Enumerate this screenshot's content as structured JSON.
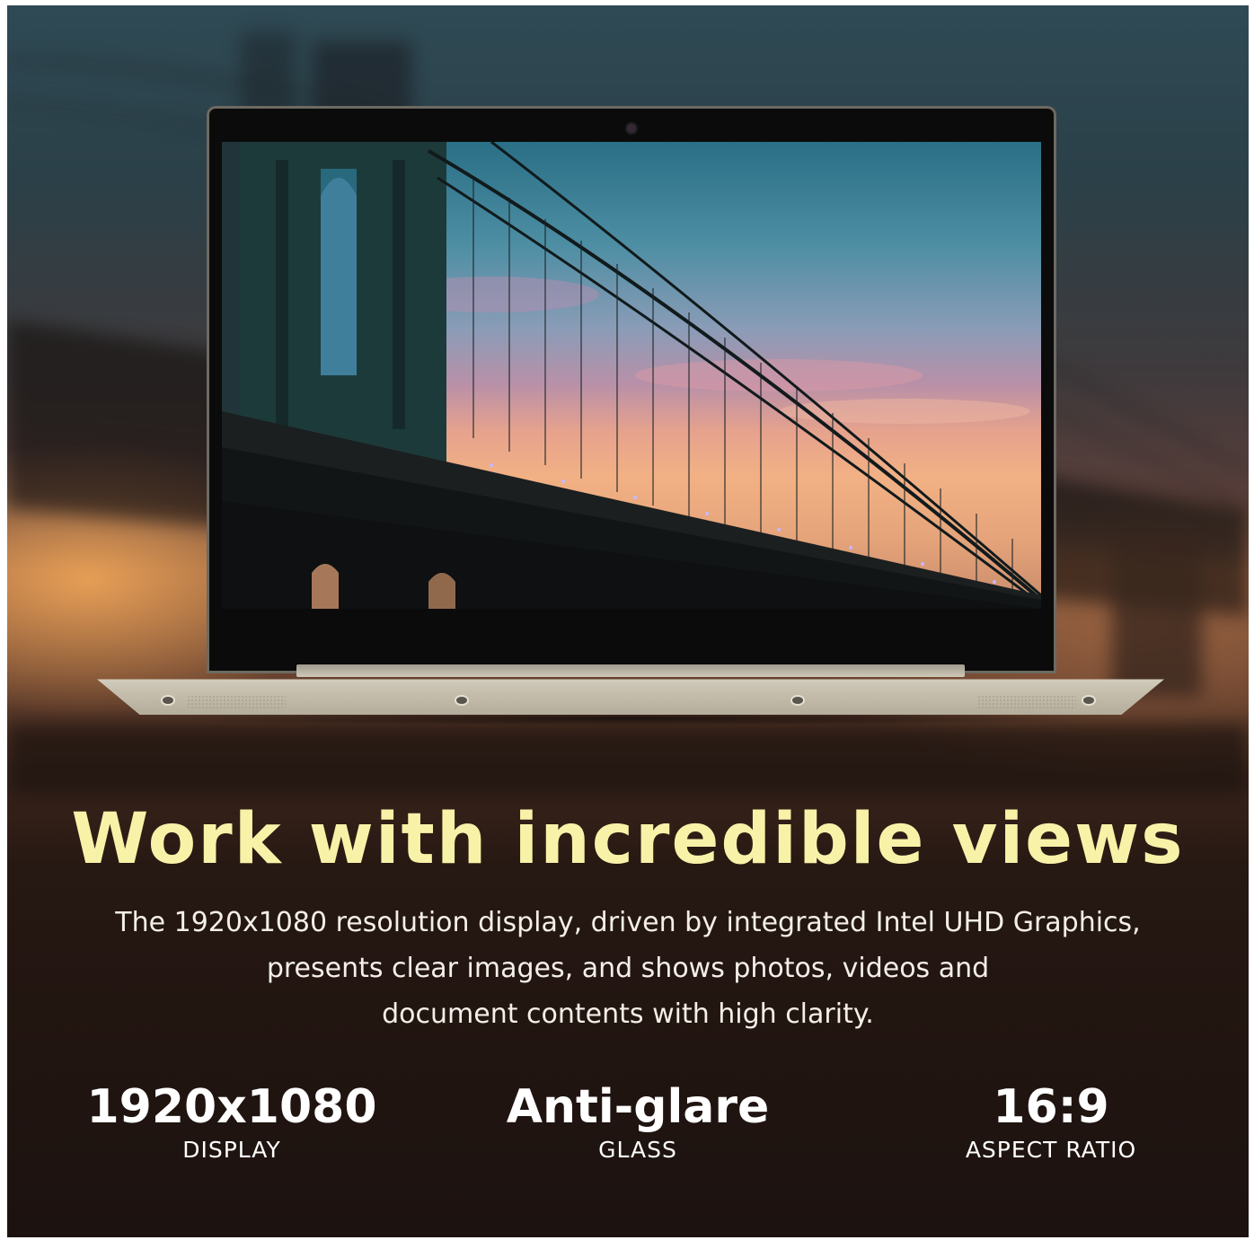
{
  "headline": "Work with incredible views",
  "description": [
    "The 1920x1080 resolution display, driven by integrated Intel UHD Graphics,",
    "presents clear images, and shows photos, videos and",
    "document contents with high clarity."
  ],
  "specs": [
    {
      "value": "1920x1080",
      "label": "DISPLAY"
    },
    {
      "value": "Anti-glare",
      "label": "GLASS"
    },
    {
      "value": "16:9",
      "label": "ASPECT RATIO"
    }
  ],
  "colors": {
    "headline": "#f8f2a8",
    "text": "#ffffff",
    "laptop_body": "#d2ccbc"
  }
}
